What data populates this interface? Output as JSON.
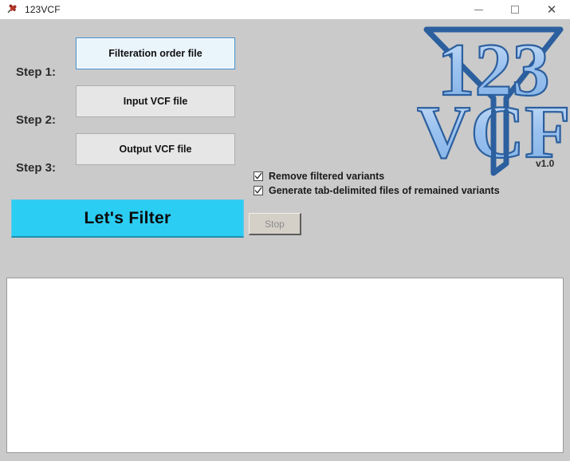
{
  "window": {
    "title": "123VCF",
    "icon": "flower-app-icon",
    "controls": {
      "minimize": "Minimize",
      "maximize": "Maximize",
      "close": "Close"
    },
    "colors": {
      "titlebar_bg": "#ffffff",
      "client_bg": "#cacaca",
      "accent_cyan": "#2ccdf3",
      "focus_blue": "#3d8fce",
      "logo_fill": "#8cb6ea",
      "logo_outline": "#2c5f9e"
    }
  },
  "steps": [
    {
      "label": "Step 1:",
      "button_label": "Filteration order file",
      "focused": true
    },
    {
      "label": "Step 2:",
      "button_label": "Input VCF file",
      "focused": false
    },
    {
      "label": "Step 3:",
      "button_label": "Output VCF file",
      "focused": false
    }
  ],
  "options": [
    {
      "label": "Remove filtered variants",
      "checked": true
    },
    {
      "label": "Generate tab-delimited files of remained variants",
      "checked": true
    }
  ],
  "actions": {
    "filter_label": "Let's Filter",
    "stop_label": "Stop",
    "stop_disabled": true
  },
  "logo": {
    "line1": "123",
    "line2": "VCF",
    "version": "v1.0"
  },
  "output": {
    "text": ""
  }
}
